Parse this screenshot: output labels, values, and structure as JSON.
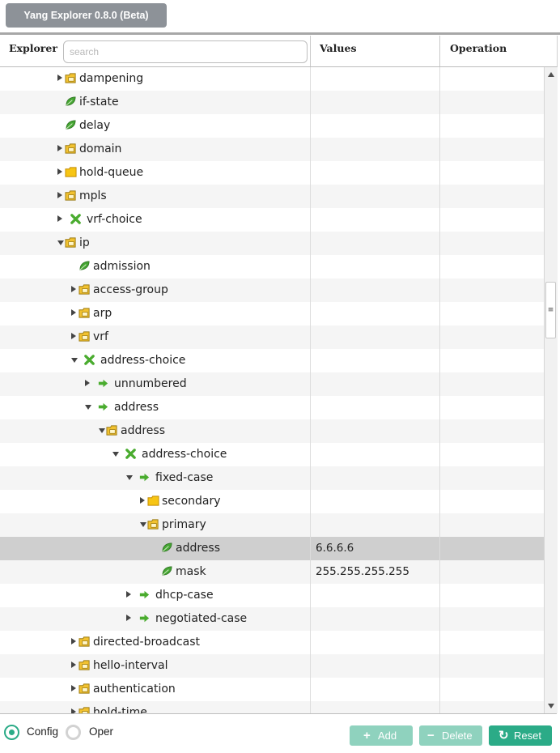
{
  "app": {
    "title": "Yang Explorer 0.8.0 (Beta)"
  },
  "columns": {
    "explorer": "Explorer",
    "values": "Values",
    "operation": "Operation"
  },
  "search": {
    "placeholder": "search",
    "value": ""
  },
  "tree": [
    {
      "label": "dampening",
      "icon": "container-icon",
      "state": "closed",
      "depth": 0,
      "value": ""
    },
    {
      "label": "if-state",
      "icon": "leaf-icon",
      "state": "none",
      "depth": 0,
      "value": ""
    },
    {
      "label": "delay",
      "icon": "leaf-icon",
      "state": "none",
      "depth": 0,
      "value": ""
    },
    {
      "label": "domain",
      "icon": "container-icon",
      "state": "closed",
      "depth": 0,
      "value": ""
    },
    {
      "label": "hold-queue",
      "icon": "folder-icon",
      "state": "closed",
      "depth": 0,
      "value": ""
    },
    {
      "label": "mpls",
      "icon": "container-icon",
      "state": "closed",
      "depth": 0,
      "value": ""
    },
    {
      "label": "vrf-choice",
      "icon": "choice-icon",
      "state": "closed",
      "depth": 0,
      "value": ""
    },
    {
      "label": "ip",
      "icon": "container-icon",
      "state": "open",
      "depth": 0,
      "value": ""
    },
    {
      "label": "admission",
      "icon": "leaf-icon",
      "state": "none",
      "depth": 1,
      "value": ""
    },
    {
      "label": "access-group",
      "icon": "container-icon",
      "state": "closed",
      "depth": 1,
      "value": ""
    },
    {
      "label": "arp",
      "icon": "container-icon",
      "state": "closed",
      "depth": 1,
      "value": ""
    },
    {
      "label": "vrf",
      "icon": "container-icon",
      "state": "closed",
      "depth": 1,
      "value": ""
    },
    {
      "label": "address-choice",
      "icon": "choice-icon",
      "state": "open",
      "depth": 1,
      "value": ""
    },
    {
      "label": "unnumbered",
      "icon": "case-icon",
      "state": "closed",
      "depth": 2,
      "value": ""
    },
    {
      "label": "address",
      "icon": "case-icon",
      "state": "open",
      "depth": 2,
      "value": ""
    },
    {
      "label": "address",
      "icon": "container-icon",
      "state": "open",
      "depth": 3,
      "value": ""
    },
    {
      "label": "address-choice",
      "icon": "choice-icon",
      "state": "open",
      "depth": 4,
      "value": ""
    },
    {
      "label": "fixed-case",
      "icon": "case-icon",
      "state": "open",
      "depth": 5,
      "value": ""
    },
    {
      "label": "secondary",
      "icon": "folder-icon",
      "state": "closed",
      "depth": 6,
      "value": ""
    },
    {
      "label": "primary",
      "icon": "container-icon",
      "state": "open",
      "depth": 6,
      "value": ""
    },
    {
      "label": "address",
      "icon": "leaf-icon",
      "state": "none",
      "depth": 7,
      "value": "6.6.6.6",
      "selected": true
    },
    {
      "label": "mask",
      "icon": "leaf-icon",
      "state": "none",
      "depth": 7,
      "value": "255.255.255.255"
    },
    {
      "label": "dhcp-case",
      "icon": "case-icon",
      "state": "closed",
      "depth": 5,
      "value": ""
    },
    {
      "label": "negotiated-case",
      "icon": "case-icon",
      "state": "closed",
      "depth": 5,
      "value": ""
    },
    {
      "label": "directed-broadcast",
      "icon": "container-icon",
      "state": "closed",
      "depth": 1,
      "value": ""
    },
    {
      "label": "hello-interval",
      "icon": "container-icon",
      "state": "closed",
      "depth": 1,
      "value": ""
    },
    {
      "label": "authentication",
      "icon": "container-icon",
      "state": "closed",
      "depth": 1,
      "value": ""
    },
    {
      "label": "hold-time",
      "icon": "container-icon",
      "state": "closed",
      "depth": 1,
      "value": ""
    }
  ],
  "mode": {
    "config_label": "Config",
    "oper_label": "Oper",
    "selected": "Config"
  },
  "buttons": {
    "add": "Add",
    "delete": "Delete",
    "reset": "Reset"
  },
  "colors": {
    "accent": "#2bab87",
    "button_disabled": "#8fd2be",
    "title_button": "#8d9298",
    "selected_row": "#cfcfcf",
    "leaf_green": "#3e9b2e",
    "folder_yellow": "#f2c230"
  }
}
